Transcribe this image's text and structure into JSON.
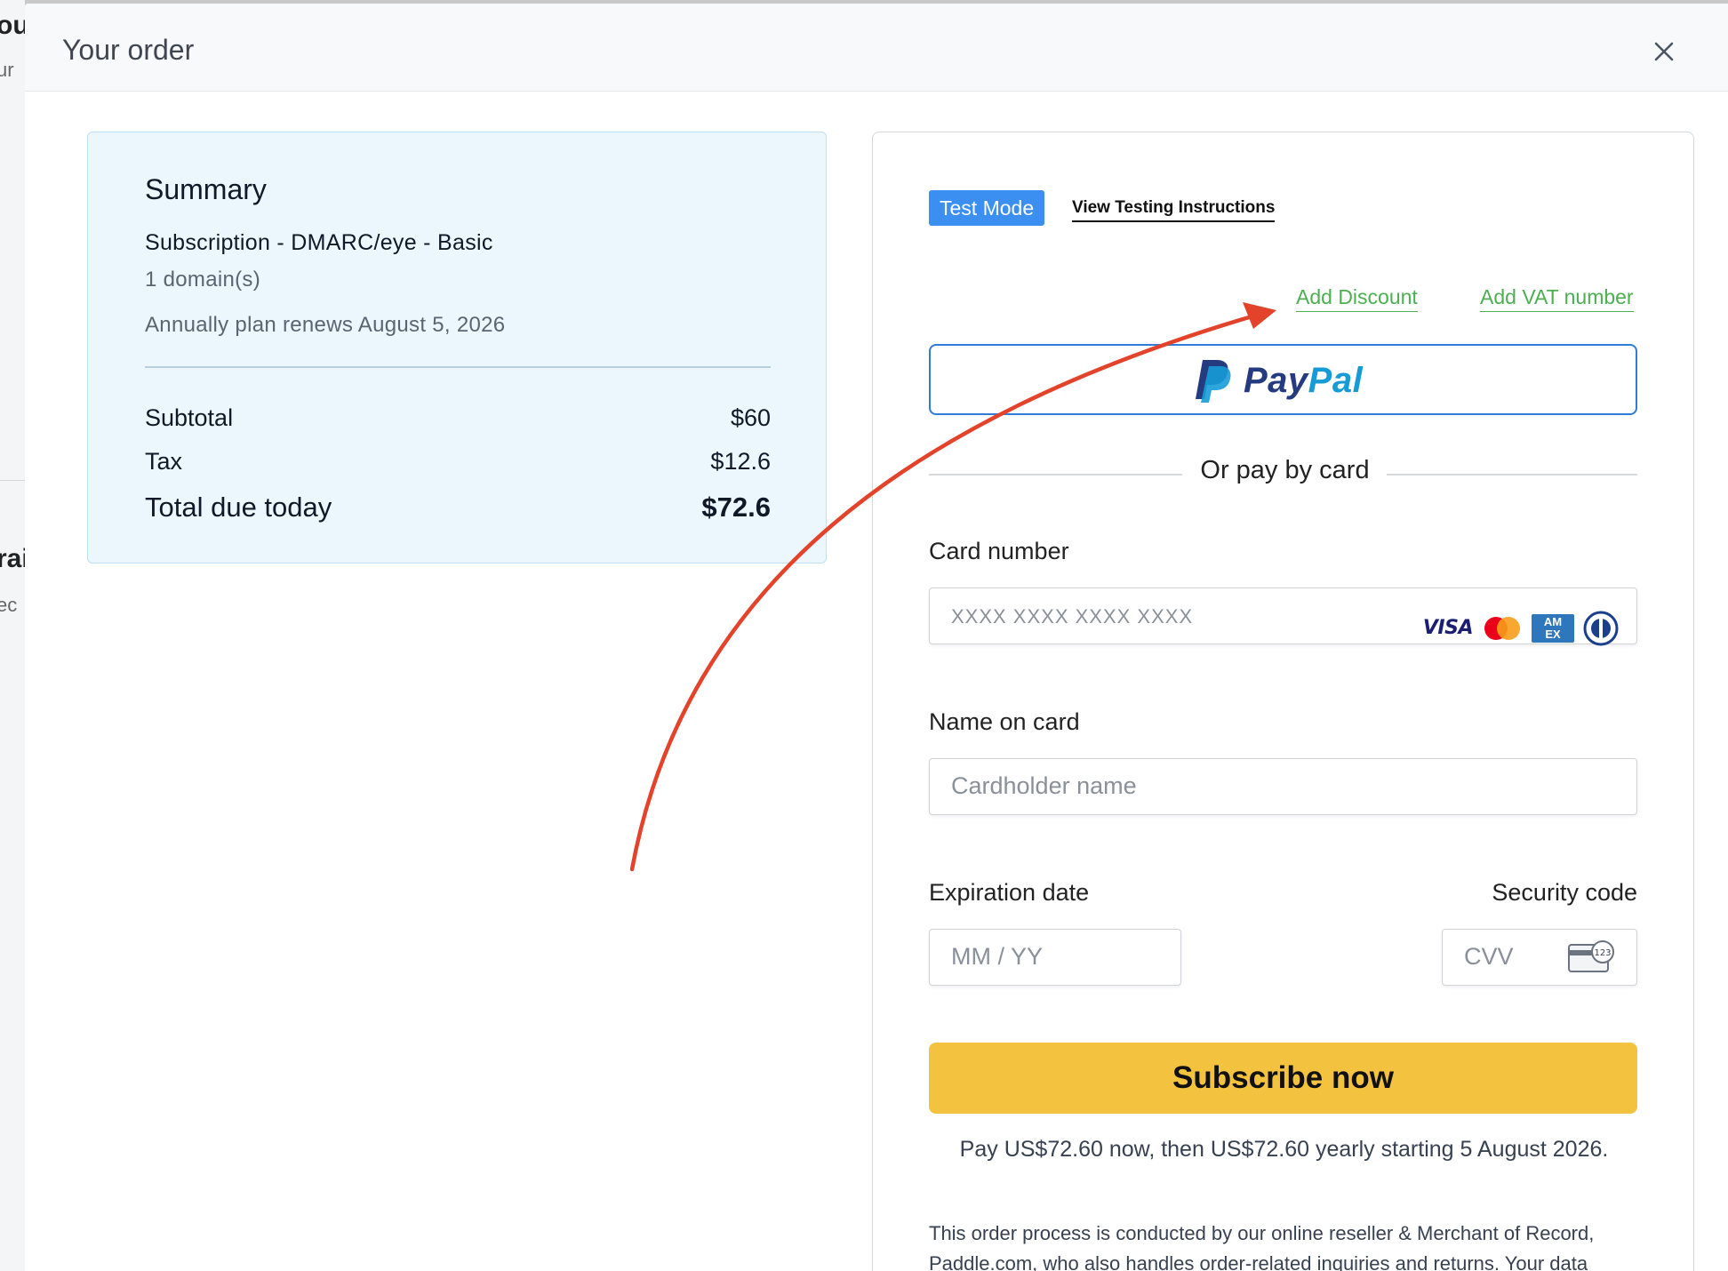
{
  "background": {
    "partial_heading_1": "ou",
    "partial_sub_1": "ur",
    "partial_heading_2": "rai",
    "partial_sub_2": "ec"
  },
  "modal": {
    "title": "Your order",
    "close_icon": "close-icon"
  },
  "summary": {
    "title": "Summary",
    "plan": "Subscription - DMARC/eye - Basic",
    "domains": "1 domain(s)",
    "renewal": "Annually plan renews August 5, 2026",
    "rows": [
      {
        "label": "Subtotal",
        "value": "$60"
      },
      {
        "label": "Tax",
        "value": "$12.6"
      }
    ],
    "total_label": "Total due today",
    "total_value": "$72.6"
  },
  "checkout": {
    "test_mode_badge": "Test Mode",
    "view_instructions_link": "View Testing Instructions",
    "add_discount_link": "Add Discount",
    "add_vat_link": "Add VAT number",
    "paypal": {
      "pay": "Pay",
      "pal": "Pal",
      "icon": "paypal-logo"
    },
    "divider_text": "Or pay by card",
    "card_number": {
      "label": "Card number",
      "placeholder": "XXXX XXXX XXXX XXXX",
      "brands": [
        "VISA",
        "Mastercard",
        "AMEX",
        "Diners Club"
      ]
    },
    "name_on_card": {
      "label": "Name on card",
      "placeholder": "Cardholder name"
    },
    "expiration": {
      "label": "Expiration date",
      "placeholder": "MM / YY"
    },
    "security": {
      "label": "Security code",
      "placeholder": "CVV",
      "icon_text": "123"
    },
    "subscribe_button": "Subscribe now",
    "pay_note": "Pay US$72.60 now, then US$72.60 yearly starting 5 August 2026.",
    "merchant_note": "This order process is conducted by our online reseller & Merchant of Record, Paddle.com, who also handles order-related inquiries and returns. Your data"
  },
  "colors": {
    "summary_bg": "#ecf6fd",
    "test_mode_bg": "#3b8ff0",
    "link_green": "#4caf50",
    "paypal_border": "#2f7dd8",
    "subscribe_bg": "#f3c23e",
    "annotation_arrow": "#e2432a"
  }
}
